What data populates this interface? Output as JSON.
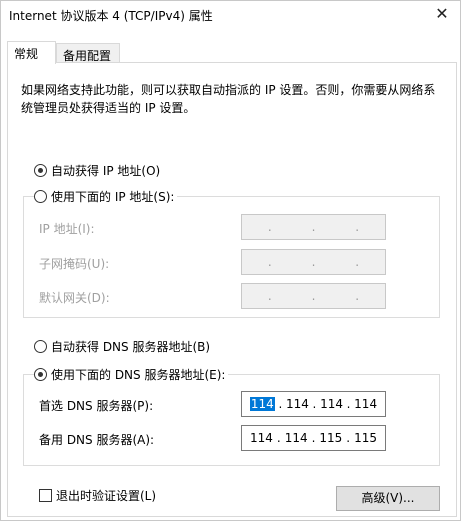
{
  "window": {
    "title": "Internet 协议版本 4 (TCP/IPv4) 属性",
    "close_glyph": "✕"
  },
  "tabs": [
    {
      "label": "常规"
    },
    {
      "label": "备用配置"
    }
  ],
  "description": "如果网络支持此功能，则可以获取自动指派的 IP 设置。否则，你需要从网络系统管理员处获得适当的 IP 设置。",
  "ip_section": {
    "auto_label": "自动获得 IP 地址(O)",
    "manual_label": "使用下面的 IP 地址(S):",
    "ip_label": "IP 地址(I):",
    "mask_label": "子网掩码(U):",
    "gateway_label": "默认网关(D):",
    "dot": "."
  },
  "dns_section": {
    "auto_label": "自动获得 DNS 服务器地址(B)",
    "manual_label": "使用下面的 DNS 服务器地址(E):",
    "preferred_label": "首选 DNS 服务器(P):",
    "alternate_label": "备用 DNS 服务器(A):",
    "preferred_segments": [
      "114",
      "114",
      "114",
      "114"
    ],
    "alternate_segments": [
      "114",
      "114",
      "115",
      "115"
    ]
  },
  "validate_label": "退出时验证设置(L)",
  "advanced_button": "高级(V)...",
  "colors": {
    "selection": "#0078d7",
    "disabled_text": "#a0a0a0"
  }
}
